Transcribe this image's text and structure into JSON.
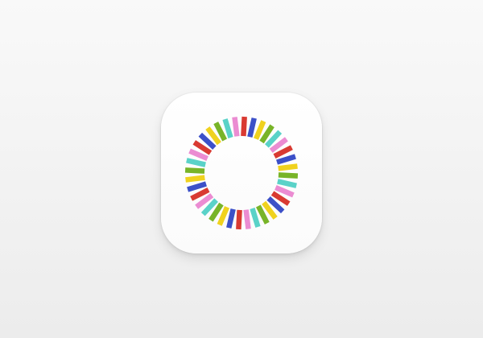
{
  "app_icon": {
    "icon_name": "radial-color-burst-icon",
    "tile_color": "#ffffff",
    "ray_count": 36,
    "ray_colors": [
      "#d93a32",
      "#3c50c8",
      "#f0d21e",
      "#78b428",
      "#5ad2c8",
      "#eb8cd2"
    ]
  }
}
